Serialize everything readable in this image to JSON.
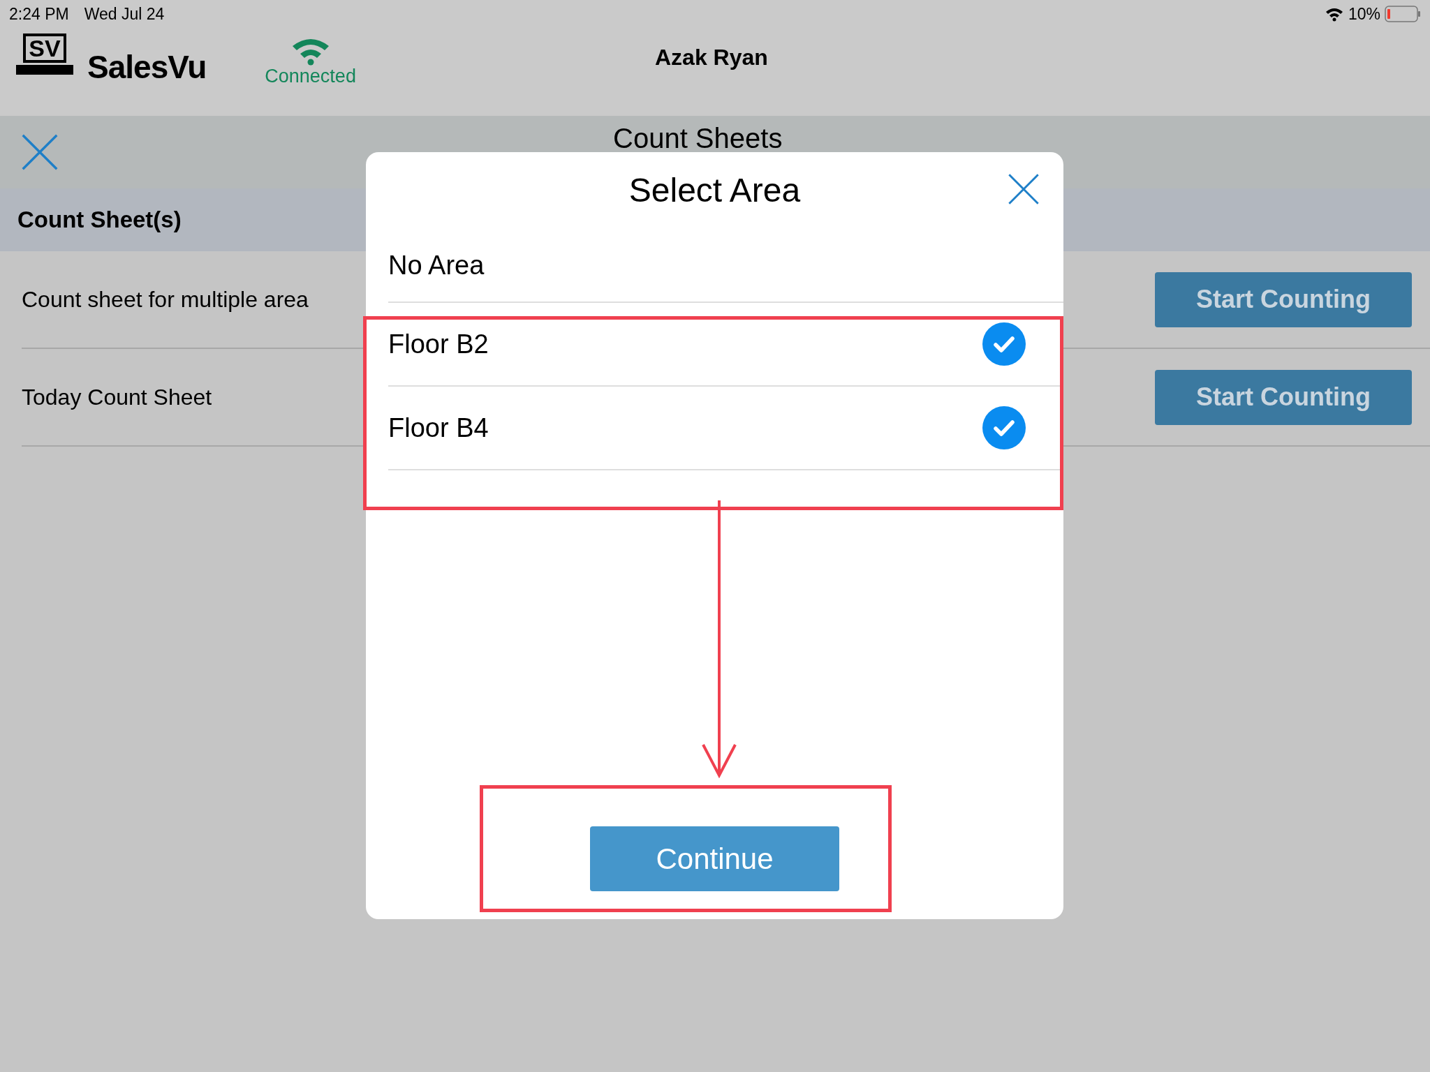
{
  "status_bar": {
    "time": "2:24 PM",
    "date": "Wed Jul 24",
    "battery": "10%"
  },
  "header": {
    "logo_mark": "SV",
    "brand": "SalesVu",
    "connection": "Connected",
    "user": "Azak Ryan"
  },
  "toolbar": {
    "title": "Count Sheets"
  },
  "section": {
    "title": "Count Sheet(s)"
  },
  "sheets": [
    {
      "name": "Count sheet for multiple area",
      "action": "Start Counting"
    },
    {
      "name": "Today Count Sheet",
      "action": "Start Counting"
    }
  ],
  "dialog": {
    "title": "Select Area",
    "areas": [
      {
        "name": "No Area",
        "checked": false
      },
      {
        "name": "Floor B2",
        "checked": true
      },
      {
        "name": "Floor B4",
        "checked": true
      }
    ],
    "button": "Continue"
  }
}
